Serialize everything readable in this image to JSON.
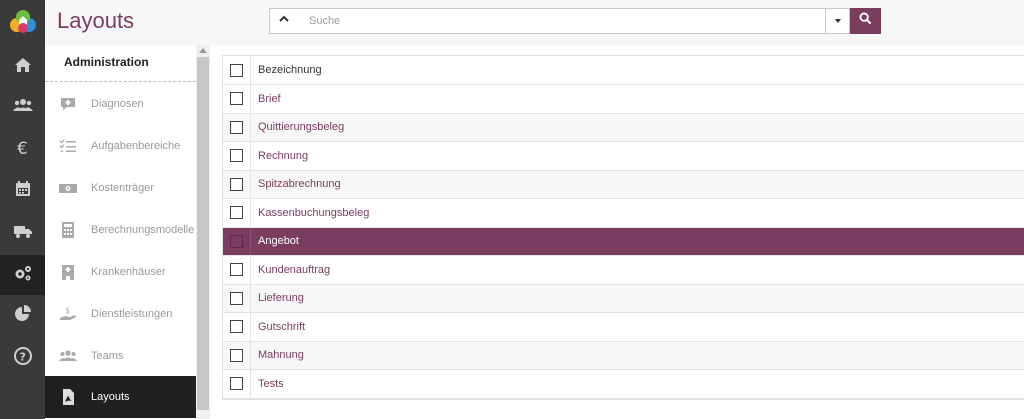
{
  "header": {
    "title": "Layouts",
    "search_placeholder": "Suche"
  },
  "rail": {
    "items": [
      {
        "icon": "home-icon"
      },
      {
        "icon": "users-icon"
      },
      {
        "icon": "euro-icon"
      },
      {
        "icon": "calendar-icon"
      },
      {
        "icon": "truck-icon"
      },
      {
        "icon": "gears-icon",
        "active": true
      },
      {
        "icon": "pie-chart-icon"
      },
      {
        "icon": "help-icon"
      }
    ]
  },
  "subnav": {
    "title": "Administration",
    "items": [
      {
        "label": "Diagnosen",
        "icon": "comment-plus-icon"
      },
      {
        "label": "Aufgabenbereiche",
        "icon": "checklist-icon"
      },
      {
        "label": "Kostenträger",
        "icon": "money-icon"
      },
      {
        "label": "Berechnungsmodelle",
        "icon": "calculator-icon"
      },
      {
        "label": "Krankenhäuser",
        "icon": "hospital-icon"
      },
      {
        "label": "Dienstleistungen",
        "icon": "hand-coin-icon"
      },
      {
        "label": "Teams",
        "icon": "team-icon"
      },
      {
        "label": "Layouts",
        "icon": "pdf-file-icon",
        "active": true
      }
    ]
  },
  "table": {
    "column_header": "Bezeichnung",
    "rows": [
      {
        "label": "Brief"
      },
      {
        "label": "Quittierungsbeleg"
      },
      {
        "label": "Rechnung"
      },
      {
        "label": "Spitzabrechnung"
      },
      {
        "label": "Kassenbuchungsbeleg"
      },
      {
        "label": "Angebot",
        "selected": true
      },
      {
        "label": "Kundenauftrag"
      },
      {
        "label": "Lieferung"
      },
      {
        "label": "Gutschrift"
      },
      {
        "label": "Mahnung"
      },
      {
        "label": "Tests"
      }
    ]
  },
  "colors": {
    "brand": "#7a3d5f",
    "rail": "#3a3a3a",
    "active_dark": "#1f1f1f"
  }
}
